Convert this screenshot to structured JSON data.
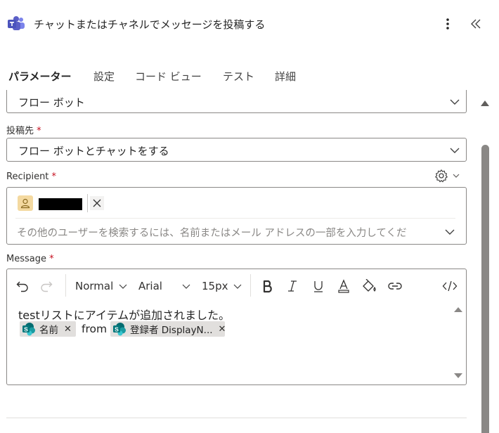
{
  "header": {
    "title": "チャットまたはチャネルでメッセージを投稿する",
    "app_icon": "teams-icon",
    "more_icon": "more-vertical-icon",
    "collapse_icon": "double-chevron-left-icon"
  },
  "tabs": [
    {
      "label": "パラメーター",
      "active": true
    },
    {
      "label": "設定",
      "active": false
    },
    {
      "label": "コード ビュー",
      "active": false
    },
    {
      "label": "テスト",
      "active": false
    },
    {
      "label": "詳細",
      "active": false
    }
  ],
  "post_as": {
    "value": "フロー ボット"
  },
  "post_in": {
    "label": "投稿先",
    "required": "*",
    "value": "フロー ボットとチャットをする"
  },
  "recipient": {
    "label": "Recipient",
    "required": "*",
    "settings_icon": "gear-icon",
    "chip_remove": "✕",
    "placeholder": "その他のユーザーを検索するには、名前またはメール アドレスの一部を入力してくだ"
  },
  "message": {
    "label": "Message",
    "required": "*",
    "toolbar": {
      "paragraph_style": "Normal",
      "font": "Arial",
      "font_size": "15px",
      "undo_icon": "undo-icon",
      "redo_icon": "redo-icon",
      "bold_icon": "bold-icon",
      "italic_icon": "italic-icon",
      "underline_icon": "underline-icon",
      "font_color_icon": "font-color-icon",
      "highlight_icon": "paint-bucket-icon",
      "link_icon": "link-icon",
      "code_view_icon": "code-icon"
    },
    "body_line1": "testリストにアイテムが追加されました。",
    "token1": "名前",
    "connector": "from",
    "token2": "登録者 DisplayN...",
    "token_remove": "✕"
  },
  "colors": {
    "accent": "#0f6cbd",
    "required": "#c50f1f",
    "sharepoint": "#03787c",
    "teams": "#5b5fc7"
  }
}
